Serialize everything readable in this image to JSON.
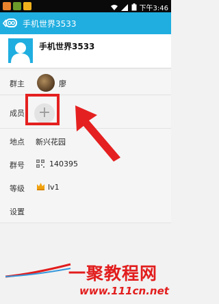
{
  "status_bar": {
    "time": "下午3:46",
    "icons": [
      "notification-app-icon",
      "chat-app-icon",
      "shopping-app-icon",
      "wifi-icon",
      "signal-icon",
      "battery-icon"
    ]
  },
  "app_bar": {
    "title": "手机世界3533",
    "color": "#20aee0"
  },
  "group": {
    "name": "手机世界3533"
  },
  "rows": {
    "owner_label": "群主",
    "owner_name": "廖",
    "members_label": "成员",
    "add_member_symbol": "+",
    "location_label": "地点",
    "location_value": "新兴花园",
    "group_number_label": "群号",
    "group_number_value": "140395",
    "level_label": "等级",
    "level_value": "lv1",
    "settings_label": "设置"
  },
  "watermark": {
    "text": "一聚教程网",
    "url": "www.111cn.net"
  },
  "colors": {
    "accent": "#20aee0",
    "highlight": "#e52020"
  }
}
